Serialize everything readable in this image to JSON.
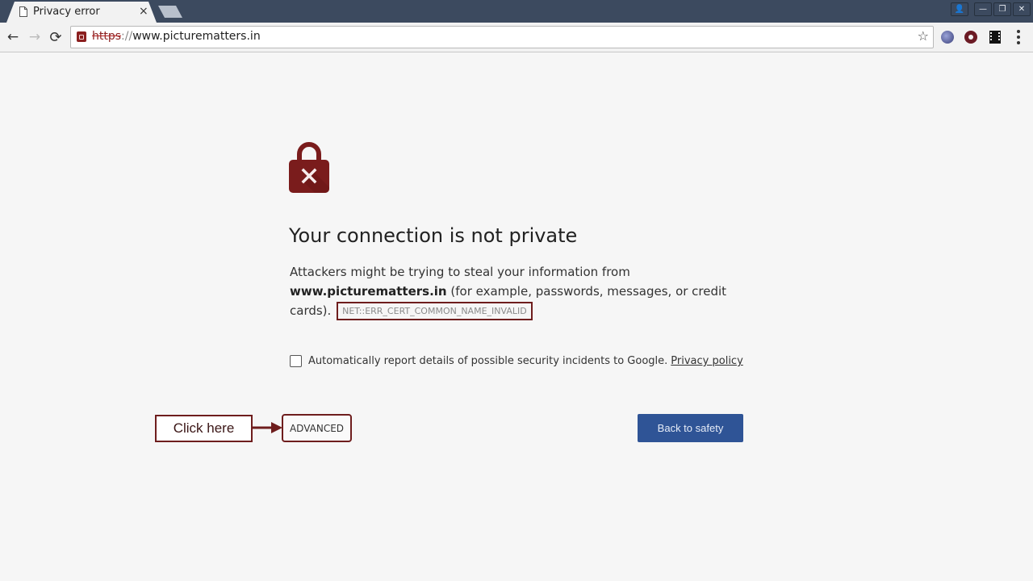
{
  "browser": {
    "tab": {
      "title": "Privacy error",
      "icon": "page-icon",
      "close_glyph": "×"
    },
    "window_controls": {
      "profile": "👤",
      "minimize": "—",
      "restore": "❐",
      "close": "✕"
    },
    "toolbar": {
      "back_glyph": "←",
      "forward_glyph": "→",
      "reload_glyph": "⟳",
      "url_scheme": "https",
      "url_separator": "://",
      "url_host": "www.picturematters.in",
      "star_glyph": "☆",
      "extensions": [
        "globe-extension",
        "record-extension",
        "film-extension"
      ]
    }
  },
  "page": {
    "icon": "lock-error-icon",
    "heading": "Your connection is not private",
    "explanation_prefix": "Attackers might be trying to steal your information from ",
    "explanation_host": "www.picturematters.in",
    "explanation_suffix": " (for example, passwords, messages, or credit cards).",
    "error_code": "NET::ERR_CERT_COMMON_NAME_INVALID",
    "report_text": "Automatically report details of possible security incidents to Google.",
    "report_checked": false,
    "privacy_link": "Privacy policy",
    "advanced_button": "ADVANCED",
    "back_button": "Back to safety",
    "annotation": "Click here"
  },
  "colors": {
    "accent_button": "#2f5496",
    "warning_red": "#8b1f1f",
    "annotation_border": "#6e1d1d"
  }
}
